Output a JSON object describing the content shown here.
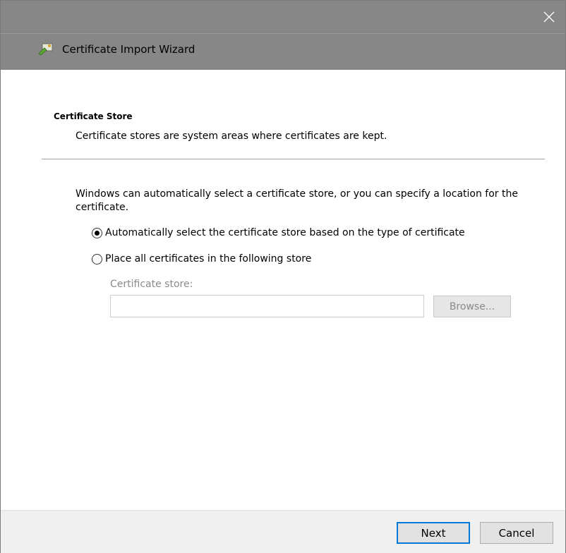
{
  "window": {
    "close_icon": "close-icon"
  },
  "header": {
    "title": "Certificate Import Wizard",
    "icon": "certificate-wizard-icon"
  },
  "section": {
    "title": "Certificate Store",
    "description": "Certificate stores are system areas where certificates are kept."
  },
  "main": {
    "intro": "Windows can automatically select a certificate store, or you can specify a location for the certificate.",
    "options": [
      {
        "label": "Automatically select the certificate store based on the type of certificate",
        "selected": true
      },
      {
        "label": "Place all certificates in the following store",
        "selected": false
      }
    ],
    "store_label": "Certificate store:",
    "store_value": "",
    "browse_label": "Browse..."
  },
  "footer": {
    "next_label": "Next",
    "cancel_label": "Cancel"
  },
  "colors": {
    "titlebar": "#878787",
    "accent": "#0078d7",
    "footer": "#f0f0f0"
  }
}
